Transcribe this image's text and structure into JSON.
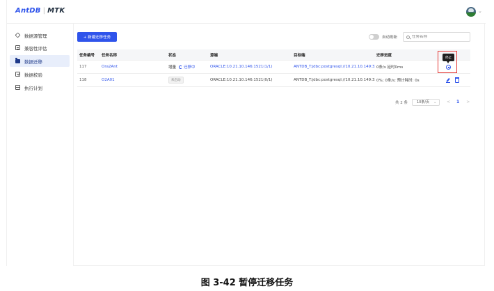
{
  "header": {
    "logo_brand": "AntDB",
    "logo_separator": "|",
    "logo_product": "MTK",
    "avatar_icon": "user-avatar-icon"
  },
  "sidebar": {
    "items": [
      {
        "label": "数据源管理",
        "icon": "layers-icon",
        "active": false
      },
      {
        "label": "兼容性评估",
        "icon": "document-icon",
        "active": false
      },
      {
        "label": "数据迁移",
        "icon": "folder-icon",
        "active": true
      },
      {
        "label": "数据校验",
        "icon": "check-icon",
        "active": false
      },
      {
        "label": "执行计划",
        "icon": "calendar-icon",
        "active": false
      }
    ]
  },
  "toolbar": {
    "new_task_label": "+ 新建迁移任务",
    "auto_refresh_label": "自动刷新",
    "auto_refresh_on": false,
    "search_placeholder": "任务名称"
  },
  "table": {
    "columns": [
      "任务编号",
      "任务名称",
      "状态",
      "源端",
      "目标端",
      "迁移进度",
      ""
    ],
    "rows": [
      {
        "id": "117",
        "name": "Ora2Ant",
        "status_text": "增量",
        "status_run": "迁移中",
        "source": "ORACLE:10.21.10.146:1521(1/1)",
        "target": "ANTDB_T:jdbc:postgresql://10.21.10.149:3333/",
        "progress": "0条/s 延时0ms"
      },
      {
        "id": "118",
        "name": "O2A01",
        "status_badge": "未启动",
        "source": "ORACLE:10.21.10.146:1521(0/1)",
        "target": "ANTDB_T:jdbc:postgresql://10.21.10.149:3333/",
        "progress": "0%; 0条/s; 预计耗时: 0s"
      }
    ]
  },
  "tooltip": {
    "stop_label": "停止"
  },
  "pagination": {
    "total_label": "共 2 条",
    "page_size_label": "10条/页",
    "prev": "<",
    "current_page": "1",
    "next": ">"
  },
  "caption": "图 3-42  暂停迁移任务",
  "colors": {
    "primary": "#2f54eb",
    "highlight_box": "#e53935",
    "active_nav_bg": "#e8eefb"
  }
}
